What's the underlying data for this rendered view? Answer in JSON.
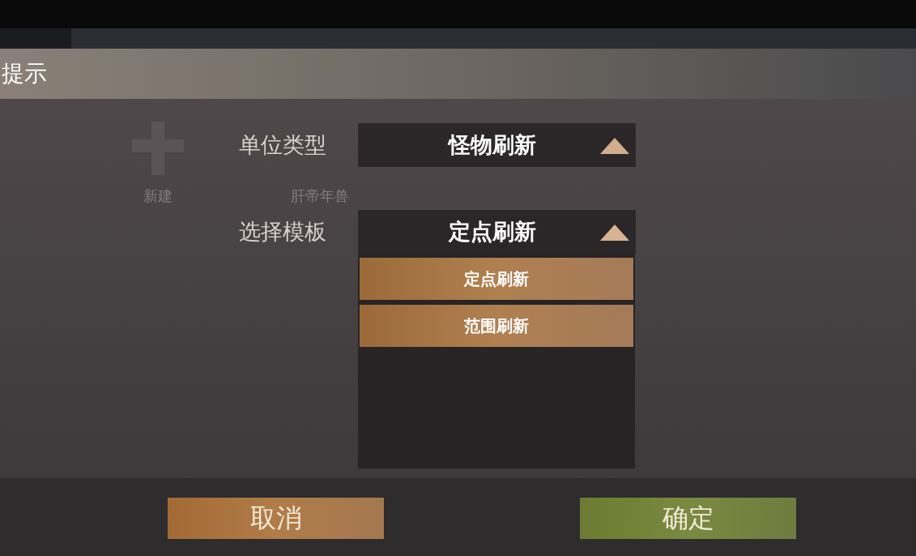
{
  "dialog": {
    "title": "提示"
  },
  "background_items": [
    {
      "kind": "new",
      "label": "新建"
    },
    {
      "kind": "entry",
      "label": "肝帝年兽"
    }
  ],
  "fields": [
    {
      "label": "单位类型",
      "value": "怪物刷新",
      "expanded": false
    },
    {
      "label": "选择模板",
      "value": "定点刷新",
      "expanded": true
    }
  ],
  "options": [
    {
      "label": "定点刷新"
    },
    {
      "label": "范围刷新"
    }
  ],
  "buttons": [
    {
      "label": "取消",
      "kind": "cancel"
    },
    {
      "label": "确定",
      "kind": "confirm"
    }
  ]
}
